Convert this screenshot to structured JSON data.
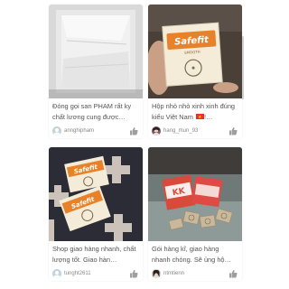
{
  "feed": {
    "posts": [
      {
        "caption": "Đóng gọi san PHAM rất ky chất lương cung được…",
        "username": "annghipham",
        "product_text": ""
      },
      {
        "caption": "Hộp nhỏ nhỏ xinh xinh đúng kiểu Việt Nam",
        "caption_suffix": "!…",
        "username": "hang_mun_93",
        "product_text": "Safefit",
        "product_subtext": "SMOOTH"
      },
      {
        "caption": "Shop giao hàng nhanh, chất lượng tốt. Giao hàn…",
        "username": "tunght2611",
        "product_text": "Safefit"
      },
      {
        "caption": "Gói hàng kĩ, giao hàng nhanh chóng. Sẽ ủng hộ…",
        "username": "ntmtienn",
        "product_text": "KK"
      }
    ]
  },
  "colors": {
    "caption": "#555555",
    "username": "#888888",
    "safefit_orange": "#e8822a",
    "box_cream": "#f4ecd8",
    "like_icon": "#9e9e9e"
  }
}
